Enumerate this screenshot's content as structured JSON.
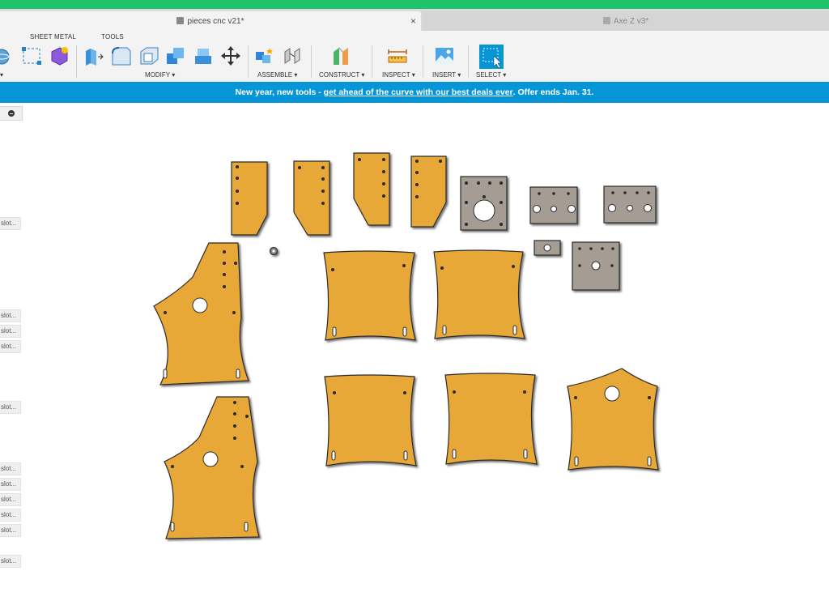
{
  "tabs": {
    "active": "pieces cnc v21*",
    "inactive": "Axe Z v3*",
    "close_glyph": "×"
  },
  "toolbar": {
    "workspace_tabs": [
      "SHEET METAL",
      "TOOLS"
    ],
    "groups": {
      "modify": "MODIFY",
      "assemble": "ASSEMBLE",
      "construct": "CONSTRUCT",
      "inspect": "INSPECT",
      "insert": "INSERT",
      "select": "SELECT"
    },
    "dropdown_glyph": "▾"
  },
  "banner": {
    "prefix": "New year, new tools - ",
    "link": "get ahead of the curve with our best deals ever",
    "suffix": ". Offer ends Jan. 31."
  },
  "browser": {
    "sketch_items": [
      "slot...",
      "slot...",
      "slot...",
      "slot...",
      "slot...",
      "slot...",
      "slot...",
      "slot...",
      "slot...",
      "slot...",
      "slot..."
    ]
  },
  "colors": {
    "accent_green": "#1fc46a",
    "banner_blue": "#0696d7",
    "part_orange": "#e8a838",
    "part_gray": "#a59d94",
    "select_blue": "#0696d7"
  }
}
